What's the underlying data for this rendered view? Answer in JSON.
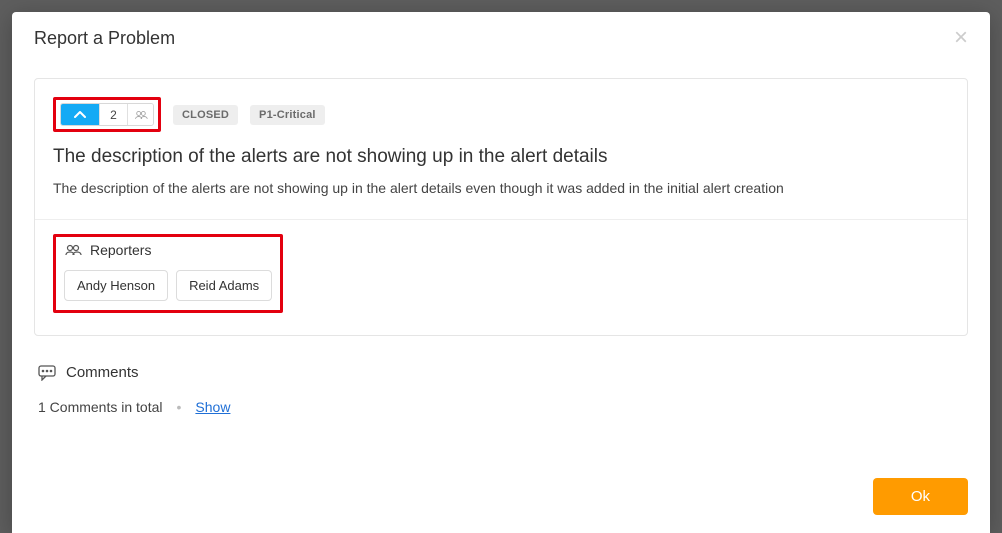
{
  "modal": {
    "title": "Report a Problem",
    "ok_label": "Ok"
  },
  "issue": {
    "vote_count": "2",
    "status": "CLOSED",
    "priority": "P1-Critical",
    "title": "The description of the alerts are not showing up in the alert details",
    "description": "The description of the alerts are not showing up in the alert details even though it was added in the initial alert creation"
  },
  "reporters": {
    "heading": "Reporters",
    "list": [
      {
        "name": "Andy Henson"
      },
      {
        "name": "Reid Adams"
      }
    ]
  },
  "comments": {
    "heading": "Comments",
    "summary": "1 Comments in total",
    "show_label": "Show"
  }
}
